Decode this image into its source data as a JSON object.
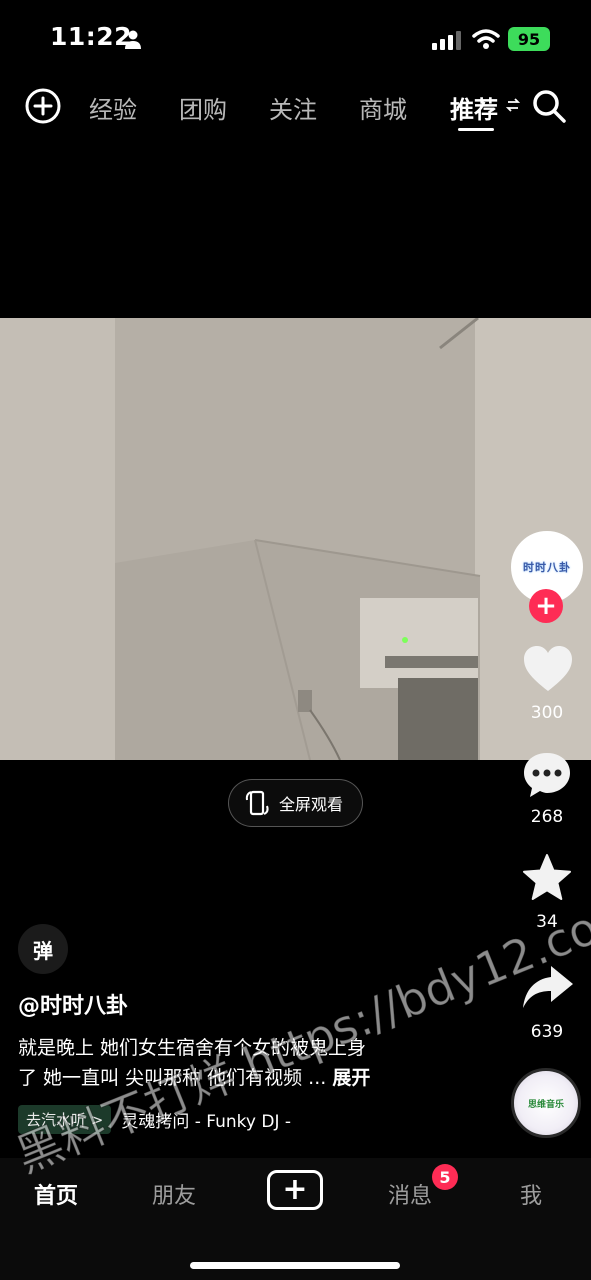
{
  "status_bar": {
    "time": "11:22",
    "battery": "95"
  },
  "top_nav": {
    "tabs": [
      {
        "label": "经验",
        "active": false
      },
      {
        "label": "团购",
        "active": false
      },
      {
        "label": "关注",
        "active": false
      },
      {
        "label": "商城",
        "active": false
      },
      {
        "label": "推荐",
        "active": true
      }
    ]
  },
  "video": {
    "fullscreen_label": "全屏观看"
  },
  "actions": {
    "avatar_text": "时时八卦",
    "likes": "300",
    "comments": "268",
    "favorites": "34",
    "shares": "639"
  },
  "info": {
    "danmu_label": "弹",
    "author": "@时时八卦",
    "caption_line1": "就是晚上 她们女生宿舍有个女的被鬼上身",
    "caption_line2": "了 她一直叫 尖叫那种 他们有视频 ...",
    "caption_more": "展开",
    "music_chip": "去汽水听 >",
    "music_name": "灵魂拷问 - Funky DJ -"
  },
  "music_disc_text": "思维音乐",
  "bottom_tabs": {
    "home": "首页",
    "friends": "朋友",
    "create": "+",
    "messages": "消息",
    "messages_badge": "5",
    "me": "我"
  },
  "watermark": "黑料不打烊 https://bdy12.co",
  "colors": {
    "accent": "#fe2c55",
    "battery": "#3ddc5b",
    "background": "#000000"
  }
}
